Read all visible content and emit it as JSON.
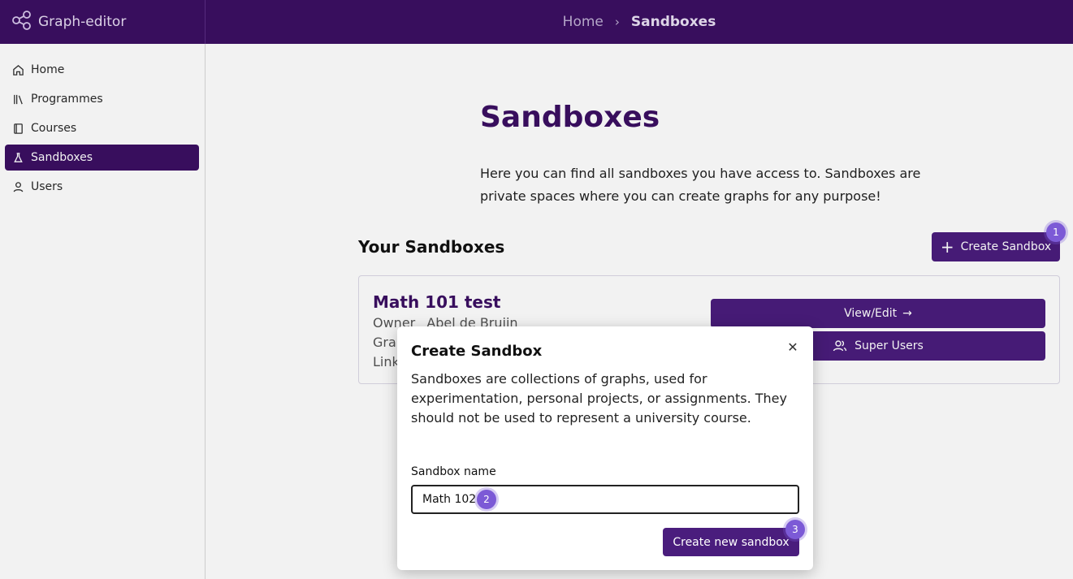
{
  "app": {
    "name": "Graph-editor",
    "accent_color": "#3b0f63",
    "logo_icon": "share-graph-icon"
  },
  "breadcrumb": {
    "home": "Home",
    "separator": "›",
    "current": "Sandboxes"
  },
  "sidebar": {
    "items": [
      {
        "label": "Home",
        "icon": "home-icon",
        "active": false
      },
      {
        "label": "Programmes",
        "icon": "library-icon",
        "active": false
      },
      {
        "label": "Courses",
        "icon": "book-icon",
        "active": false
      },
      {
        "label": "Sandboxes",
        "icon": "flask-icon",
        "active": true
      },
      {
        "label": "Users",
        "icon": "user-icon",
        "active": false
      }
    ]
  },
  "main": {
    "title": "Sandboxes",
    "description": "Here you can find all sandboxes you have access to. Sandboxes are private spaces where you can create graphs for any purpose!",
    "section_title": "Your Sandboxes",
    "create_button": "Create Sandbox",
    "create_icon": "plus-icon"
  },
  "sandbox_card": {
    "title": "Math 101 test",
    "owner_label": "Owner",
    "owner_value": "Abel de Bruijn",
    "row2_partial": "Grap",
    "row3_partial": "Link",
    "view_button": "View/Edit",
    "view_icon": "arrow-right-icon",
    "super_users_button": "Super Users",
    "super_users_icon": "users-icon"
  },
  "modal": {
    "title": "Create Sandbox",
    "close_icon": "close-icon",
    "description": "Sandboxes are collections of graphs, used for experimentation, personal projects, or assignments. They should not be used to represent a university course.",
    "field_label": "Sandbox name",
    "field_value": "Math 102",
    "submit_button": "Create new sandbox"
  },
  "markers": [
    "1",
    "2",
    "3"
  ]
}
